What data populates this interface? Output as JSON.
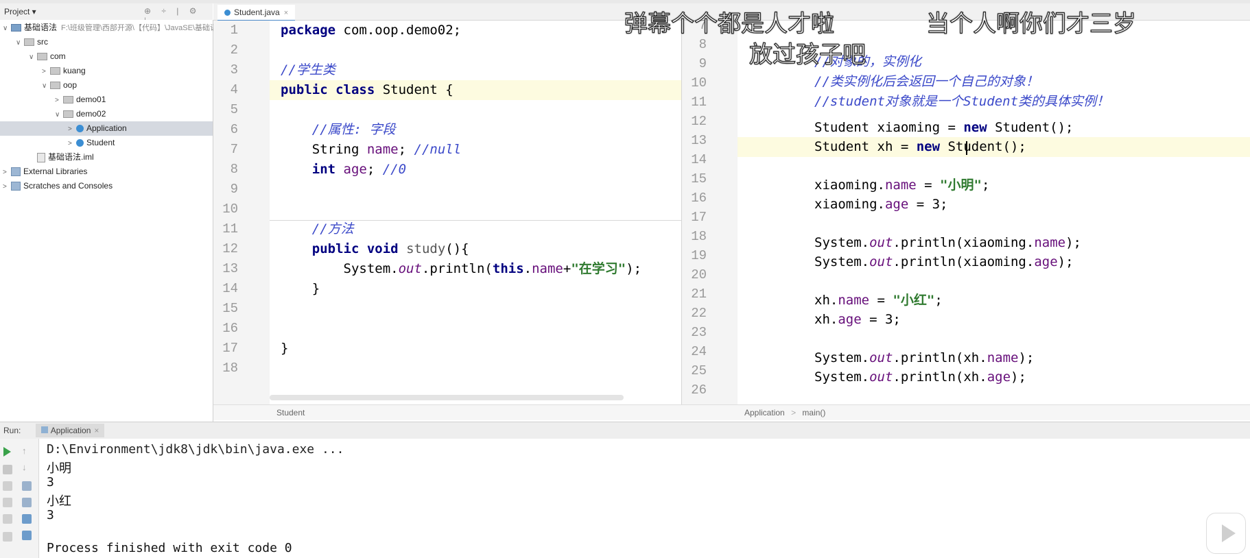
{
  "project": {
    "header_label": "Project ▾",
    "tree": [
      {
        "label": "基础语法",
        "path": "F:\\班级管理\\西部开源\\【代码】\\JavaSE\\基础语法",
        "icon": "module-icon",
        "level": 0,
        "arrow": "∨"
      },
      {
        "label": "src",
        "icon": "folder-icon",
        "level": 1,
        "arrow": "∨"
      },
      {
        "label": "com",
        "icon": "folder-icon",
        "level": 2,
        "arrow": "∨"
      },
      {
        "label": "kuang",
        "icon": "folder-icon",
        "level": 3,
        "arrow": ">"
      },
      {
        "label": "oop",
        "icon": "folder-icon",
        "level": 3,
        "arrow": "∨"
      },
      {
        "label": "demo01",
        "icon": "folder-icon",
        "level": 4,
        "arrow": ">"
      },
      {
        "label": "demo02",
        "icon": "folder-icon",
        "level": 4,
        "arrow": "∨"
      },
      {
        "label": "Application",
        "icon": "class-icon",
        "level": 5,
        "arrow": ">",
        "selected": true
      },
      {
        "label": "Student",
        "icon": "class-icon",
        "level": 5,
        "arrow": ">"
      },
      {
        "label": "基础语法.iml",
        "icon": "file-icon",
        "level": 2,
        "arrow": ""
      },
      {
        "label": "External Libraries",
        "icon": "library-icon",
        "level": 0,
        "arrow": ">"
      },
      {
        "label": "Scratches and Consoles",
        "icon": "scratch-icon",
        "level": 0,
        "arrow": ">"
      }
    ]
  },
  "tabs": {
    "active": "Student.java",
    "close": "×"
  },
  "left_editor": {
    "breadcrumb": "Student",
    "line_numbers": [
      "1",
      "2",
      "3",
      "4",
      "5",
      "6",
      "7",
      "8",
      "9",
      "10",
      "11",
      "12",
      "13",
      "14",
      "15",
      "16",
      "17",
      "18"
    ]
  },
  "right_editor": {
    "breadcrumb_class": "Application",
    "breadcrumb_method": "main()",
    "breadcrumb_sep": ">",
    "line_numbers": [
      "7",
      "8",
      "9",
      "10",
      "11",
      "12",
      "13",
      "14",
      "15",
      "16",
      "17",
      "18",
      "19",
      "20",
      "21",
      "22",
      "23",
      "24",
      "25",
      "26"
    ]
  },
  "run": {
    "tab_run": "Run:",
    "tab_app": "Application",
    "tab_close": "×",
    "lines": [
      "D:\\Environment\\jdk8\\jdk\\bin\\java.exe ...",
      "小明",
      "3",
      "小红",
      "3",
      "",
      "Process finished with exit code 0"
    ]
  },
  "danmaku": [
    "弹幕个个都是人才啦",
    "当个人啊你们才三岁",
    "放过孩子吧"
  ],
  "colors": {
    "keyword": "#000080",
    "comment": "#3b49c9",
    "string": "#2f7a2f",
    "field": "#660e7a"
  }
}
